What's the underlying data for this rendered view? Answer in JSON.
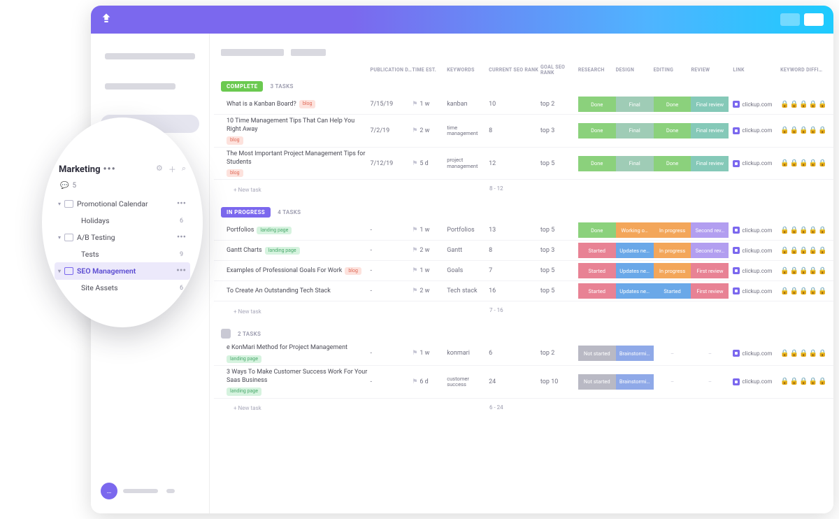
{
  "popout": {
    "title": "Marketing",
    "comments_count": "5",
    "tree": [
      {
        "name": "Promotional Calendar",
        "count": "",
        "folder": true,
        "caret": true,
        "dots": true
      },
      {
        "name": "Holidays",
        "count": "6",
        "sub": true
      },
      {
        "name": "A/B Testing",
        "count": "",
        "folder": true,
        "caret": true,
        "dots": true
      },
      {
        "name": "Tests",
        "count": "9",
        "sub": true
      },
      {
        "name": "SEO Management",
        "count": "",
        "folder": true,
        "caret": true,
        "dots": true,
        "active": true
      },
      {
        "name": "Site Assets",
        "count": "6",
        "sub": true
      }
    ]
  },
  "columns": {
    "pub": "PUBLICATION D…",
    "time": "TIME EST.",
    "kw": "KEYWORDS",
    "seo": "CURRENT SEO RANK",
    "goal": "GOAL SEO RANK",
    "research": "RESEARCH",
    "design": "DESIGN",
    "editing": "EDITING",
    "review": "REVIEW",
    "link": "LINK",
    "diff": "KEYWORD DIFFI…"
  },
  "statuses": {
    "done": "Done",
    "final": "Final",
    "final_review": "Final review",
    "working": "Working o…",
    "inprog": "In progress",
    "second": "Second rev…",
    "started": "Started",
    "updates": "Updates ne…",
    "first": "First review",
    "notstart": "Not started",
    "brain": "Brainstormi…"
  },
  "link_text": "clickup.com",
  "new_task_label": "+ New task",
  "groups": [
    {
      "status_label": "COMPLETE",
      "status_class": "status-complete",
      "count_label": "3 TASKS",
      "subtotal": "8 - 12",
      "tasks": [
        {
          "name": "What is a Kanban Board?",
          "tag": "blog",
          "pub": "7/15/19",
          "time": "1 w",
          "kw": "kanban",
          "seo": "10",
          "goal": "top 2",
          "s": [
            "s-done",
            "s-final",
            "s-done",
            "s-review"
          ],
          "sv": [
            "done",
            "final",
            "done",
            "final_review"
          ],
          "link": true,
          "diff": [
            1,
            1,
            1,
            1,
            0
          ]
        },
        {
          "name": "10 Time Management Tips That Can Help You Right Away",
          "tag": "blog",
          "pub": "7/2/19",
          "time": "2 w",
          "kw": "time management",
          "kwmulti": true,
          "seo": "8",
          "goal": "top 3",
          "s": [
            "s-done",
            "s-final",
            "s-done",
            "s-review"
          ],
          "sv": [
            "done",
            "final",
            "done",
            "final_review"
          ],
          "link": true,
          "diff": [
            1,
            1,
            1,
            1,
            0
          ]
        },
        {
          "name": "The Most Important Project Management Tips for Students",
          "tag": "blog",
          "pub": "7/12/19",
          "time": "5 d",
          "kw": "project management",
          "kwmulti": true,
          "seo": "12",
          "goal": "top 5",
          "s": [
            "s-done",
            "s-final",
            "s-done",
            "s-review"
          ],
          "sv": [
            "done",
            "final",
            "done",
            "final_review"
          ],
          "link": true,
          "diff": [
            1,
            1,
            1,
            1,
            0
          ]
        }
      ]
    },
    {
      "status_label": "IN PROGRESS",
      "status_class": "status-progress",
      "count_label": "4 TASKS",
      "subtotal": "7 - 16",
      "tasks": [
        {
          "name": "Portfolios",
          "tag": "landing page",
          "tagclass": "tag-lp",
          "pub": "-",
          "time": "1 w",
          "kw": "Portfolios",
          "seo": "13",
          "goal": "top 5",
          "s": [
            "s-done",
            "s-working",
            "s-inprog",
            "s-second"
          ],
          "sv": [
            "done",
            "working",
            "inprog",
            "second"
          ],
          "link": true,
          "diff": [
            1,
            1,
            1,
            1,
            0
          ]
        },
        {
          "name": "Gantt Charts",
          "tag": "landing page",
          "tagclass": "tag-lp",
          "pub": "-",
          "time": "2 w",
          "kw": "Gantt",
          "seo": "8",
          "goal": "top 3",
          "s": [
            "s-started",
            "s-updates",
            "s-inprog",
            "s-second"
          ],
          "sv": [
            "started",
            "updates",
            "inprog",
            "second"
          ],
          "link": true,
          "diff": [
            1,
            1,
            1,
            1,
            0
          ]
        },
        {
          "name": "Examples of Professional Goals For Work",
          "tag": "blog",
          "tagclass": "tag-blog",
          "pub": "-",
          "time": "1 w",
          "kw": "Goals",
          "seo": "7",
          "goal": "top 5",
          "s": [
            "s-started",
            "s-updates",
            "s-inprog",
            "s-first"
          ],
          "sv": [
            "started",
            "updates",
            "inprog",
            "first"
          ],
          "link": true,
          "diff": [
            1,
            1,
            1,
            0,
            0
          ]
        },
        {
          "name": "To Create An Outstanding Tech Stack",
          "tag": "",
          "pub": "-",
          "time": "2 w",
          "kw": "Tech stack",
          "seo": "16",
          "goal": "top 5",
          "s": [
            "s-started",
            "s-updates",
            "s-startblue",
            "s-first"
          ],
          "sv": [
            "started",
            "updates",
            "started",
            "first"
          ],
          "link": true,
          "diff": [
            1,
            1,
            1,
            1,
            0
          ]
        }
      ]
    },
    {
      "status_label": "",
      "status_class": "status-open",
      "count_label": "2 TASKS",
      "subtotal": "6 - 24",
      "tasks": [
        {
          "name": "e KonMari Method for Project Management",
          "tag": "landing page",
          "tagclass": "tag-lp",
          "pub": "-",
          "time": "1 w",
          "kw": "konmari",
          "seo": "6",
          "goal": "top 2",
          "s": [
            "s-notstart",
            "s-brain",
            "s-empty",
            "s-empty"
          ],
          "sv": [
            "notstart",
            "brain",
            "",
            ""
          ],
          "link": true,
          "diff": [
            1,
            1,
            1,
            1,
            0
          ]
        },
        {
          "name": "3 Ways To Make Customer Success Work For Your Saas Business",
          "tag": "landing page",
          "tagclass": "tag-lp",
          "pub": "-",
          "time": "6 d",
          "kw": "customer success",
          "kwmulti": true,
          "seo": "24",
          "goal": "top 10",
          "s": [
            "s-notstart",
            "s-brain",
            "s-empty",
            "s-empty"
          ],
          "sv": [
            "notstart",
            "brain",
            "",
            ""
          ],
          "link": true,
          "diff": [
            1,
            1,
            1,
            1,
            0
          ]
        }
      ]
    }
  ]
}
